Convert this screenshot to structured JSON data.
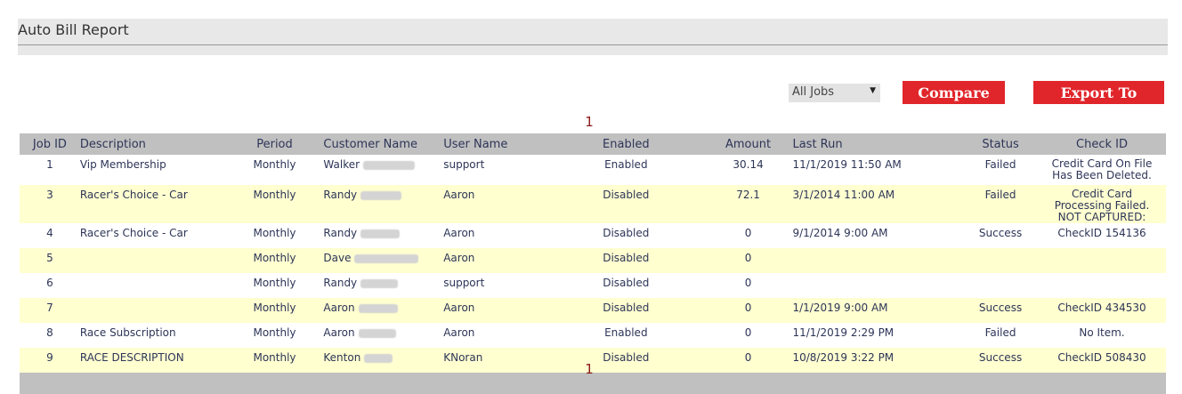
{
  "page": {
    "title": "Auto Bill Report"
  },
  "controls": {
    "jobs_select": "All Jobs",
    "compare_label": "Compare To",
    "export_label": "Export To Excel"
  },
  "pager": {
    "top": "1",
    "bottom": "1"
  },
  "table": {
    "headers": [
      "Job ID",
      "Description",
      "Period",
      "Customer Name",
      "User Name",
      "Enabled",
      "Amount",
      "Last Run",
      "Status",
      "Check ID"
    ],
    "rows": [
      {
        "id": "1",
        "description": "Vip Membership",
        "period": "Monthly",
        "customer": "Walker",
        "user": "support",
        "enabled": "Enabled",
        "amount": "30.14",
        "last_run": "11/1/2019 11:50 AM",
        "status": "Failed",
        "check": "Credit Card On File Has Been Deleted."
      },
      {
        "id": "3",
        "description": "Racer's Choice - Car",
        "period": "Monthly",
        "customer": "Randy",
        "user": "Aaron",
        "enabled": "Disabled",
        "amount": "72.1",
        "last_run": "3/1/2014 11:00 AM",
        "status": "Failed",
        "check": "Credit Card Processing Failed. NOT CAPTURED:"
      },
      {
        "id": "4",
        "description": "Racer's Choice - Car",
        "period": "Monthly",
        "customer": "Randy",
        "user": "Aaron",
        "enabled": "Disabled",
        "amount": "0",
        "last_run": "9/1/2014 9:00 AM",
        "status": "Success",
        "check": "CheckID 154136"
      },
      {
        "id": "5",
        "description": "",
        "period": "Monthly",
        "customer": "Dave",
        "user": "Aaron",
        "enabled": "Disabled",
        "amount": "0",
        "last_run": "",
        "status": "",
        "check": ""
      },
      {
        "id": "6",
        "description": "",
        "period": "Monthly",
        "customer": "Randy",
        "user": "support",
        "enabled": "Disabled",
        "amount": "0",
        "last_run": "",
        "status": "",
        "check": ""
      },
      {
        "id": "7",
        "description": "",
        "period": "Monthly",
        "customer": "Aaron",
        "user": "Aaron",
        "enabled": "Disabled",
        "amount": "0",
        "last_run": "1/1/2019 9:00 AM",
        "status": "Success",
        "check": "CheckID 434530"
      },
      {
        "id": "8",
        "description": "Race Subscription",
        "period": "Monthly",
        "customer": "Aaron",
        "user": "Aaron",
        "enabled": "Enabled",
        "amount": "0",
        "last_run": "11/1/2019 2:29 PM",
        "status": "Failed",
        "check": "No Item."
      },
      {
        "id": "9",
        "description": "RACE DESCRIPTION",
        "period": "Monthly",
        "customer": "Kenton",
        "user": "KNoran",
        "enabled": "Disabled",
        "amount": "0",
        "last_run": "10/8/2019 3:22 PM",
        "status": "Success",
        "check": "CheckID 508430"
      }
    ]
  },
  "colors": {
    "accent": "#e0262b",
    "header_bg": "#c0c0c0",
    "alt_row": "#ffffd0",
    "panel": "#e8e8e8"
  }
}
